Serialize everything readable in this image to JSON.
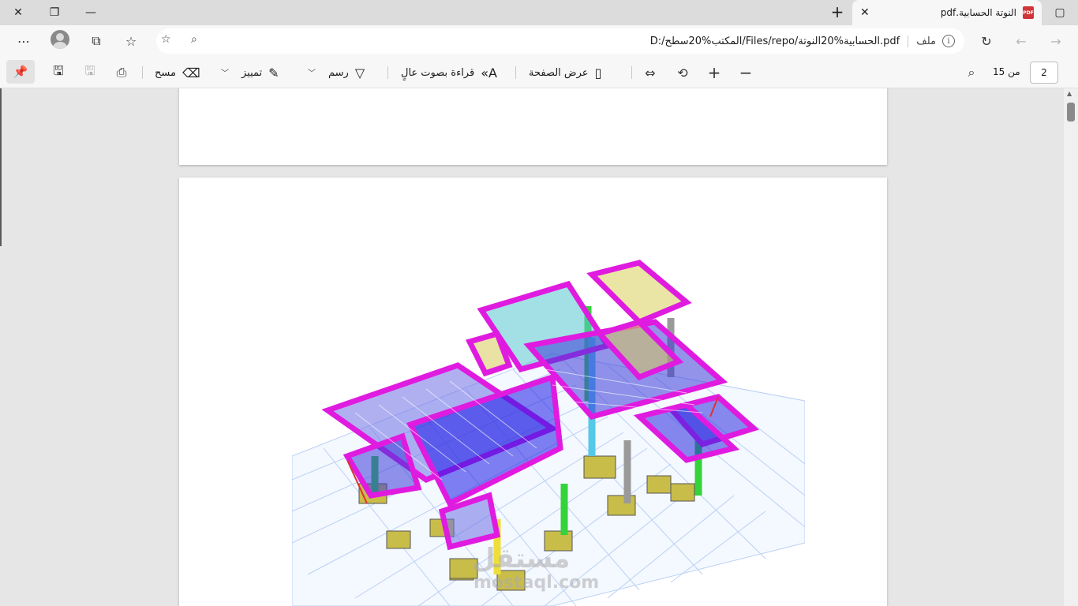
{
  "tab": {
    "title": "النوتة الحسابية.pdf",
    "file_icon": "PDF"
  },
  "address": {
    "scheme_label": "ملف",
    "url": "D:/المكتب%20سطح/Files/repo/الحسابية%20النوتة.pdf"
  },
  "pdf_toolbar": {
    "erase_label": "مسح",
    "highlight_label": "تمييز",
    "draw_label": "رسم",
    "read_aloud_label": "قراءة بصوت عالٍ",
    "page_view_label": "عرض الصفحة",
    "current_page": "2",
    "page_count_label": "من 15"
  },
  "watermark": {
    "text": "مستقل",
    "site": "mostaql.com"
  }
}
